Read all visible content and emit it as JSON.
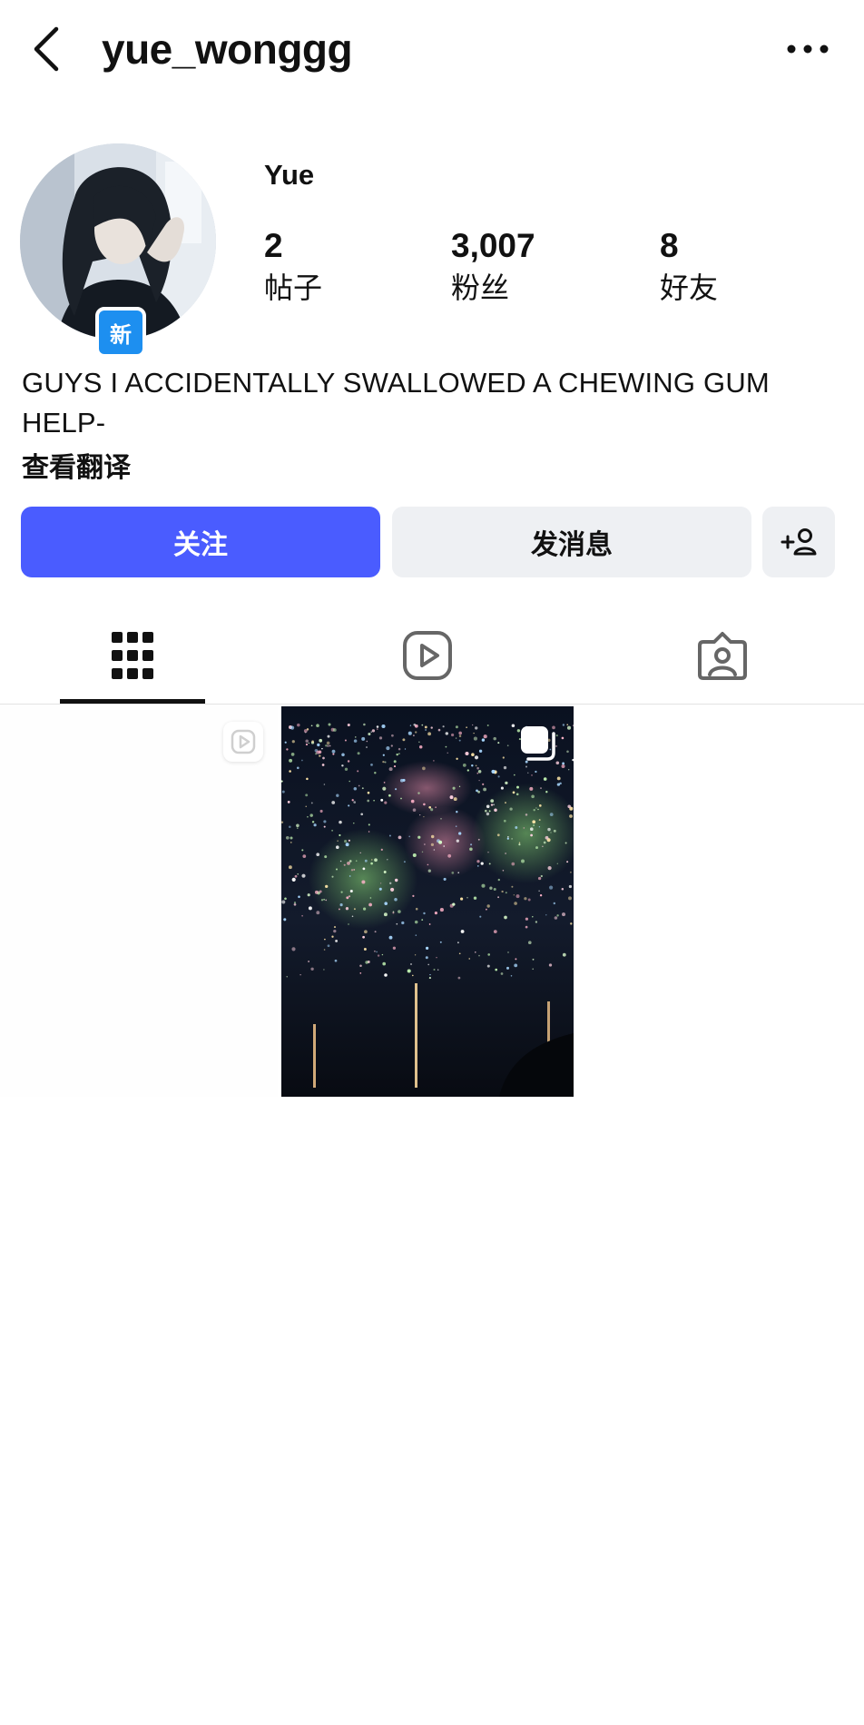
{
  "header": {
    "username": "yue_wonggg"
  },
  "profile": {
    "display_name": "Yue",
    "badge": "新",
    "stats": [
      {
        "value": "2",
        "label": "帖子"
      },
      {
        "value": "3,007",
        "label": "粉丝"
      },
      {
        "value": "8",
        "label": "好友"
      }
    ],
    "bio": "GUYS I ACCIDENTALLY SWALLOWED A CHEWING GUM HELP-",
    "translate_link": "查看翻译"
  },
  "actions": {
    "follow": "关注",
    "message": "发消息",
    "add_friend_icon": "add-person-icon"
  },
  "tabs": [
    {
      "icon": "grid-icon",
      "selected": true
    },
    {
      "icon": "reels-play-icon",
      "selected": false
    },
    {
      "icon": "tagged-person-icon",
      "selected": false
    }
  ],
  "colors": {
    "accent": "#4a5cff",
    "badge": "#1d8ff0",
    "secondary_button": "#eef0f3"
  }
}
